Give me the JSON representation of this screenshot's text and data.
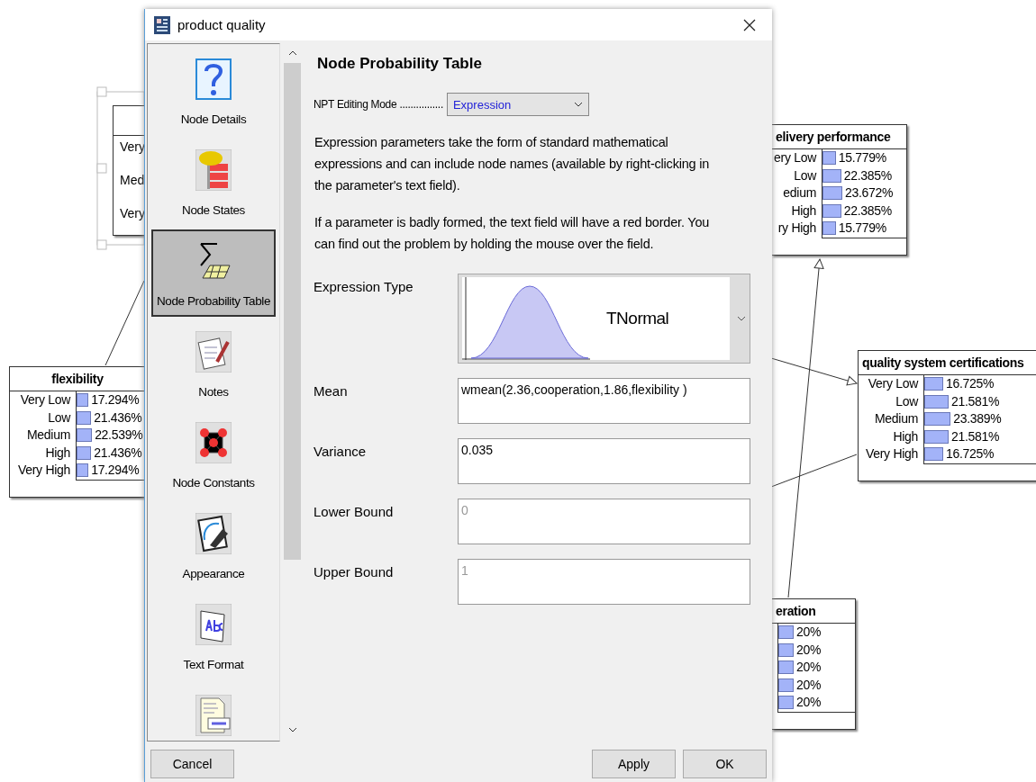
{
  "canvas": {
    "partial_node": {
      "rows": [
        {
          "label": "Very"
        },
        {
          "label": "Med"
        },
        {
          "label": "Very"
        }
      ]
    },
    "nodes": [
      {
        "title": "flexibility",
        "states": [
          {
            "label": "Very Low",
            "value": "17.294%",
            "level": 0.17294
          },
          {
            "label": "Low",
            "value": "21.436%",
            "level": 0.21436
          },
          {
            "label": "Medium",
            "value": "22.539%",
            "level": 0.22539
          },
          {
            "label": "High",
            "value": "21.436%",
            "level": 0.21436
          },
          {
            "label": "Very High",
            "value": "17.294%",
            "level": 0.17294
          }
        ]
      },
      {
        "title": "elivery performance",
        "states": [
          {
            "label": "ery Low",
            "value": "15.779%",
            "level": 0.15779
          },
          {
            "label": "Low",
            "value": "22.385%",
            "level": 0.22385
          },
          {
            "label": "edium",
            "value": "23.672%",
            "level": 0.23672
          },
          {
            "label": "High",
            "value": "22.385%",
            "level": 0.22385
          },
          {
            "label": "ry High",
            "value": "15.779%",
            "level": 0.15779
          }
        ]
      },
      {
        "title": "quality system certifications",
        "states": [
          {
            "label": "Very Low",
            "value": "16.725%",
            "level": 0.16725
          },
          {
            "label": "Low",
            "value": "21.581%",
            "level": 0.21581
          },
          {
            "label": "Medium",
            "value": "23.389%",
            "level": 0.23389
          },
          {
            "label": "High",
            "value": "21.581%",
            "level": 0.21581
          },
          {
            "label": "Very High",
            "value": "16.725%",
            "level": 0.16725
          }
        ]
      },
      {
        "title": "eration",
        "states": [
          {
            "value": "20%",
            "level": 0.2
          },
          {
            "value": "20%",
            "level": 0.2
          },
          {
            "value": "20%",
            "level": 0.2
          },
          {
            "value": "20%",
            "level": 0.2
          },
          {
            "value": "20%",
            "level": 0.2
          }
        ]
      }
    ]
  },
  "window": {
    "title": "product quality"
  },
  "sidebar": {
    "items": [
      {
        "label": "Node Details",
        "selected": false
      },
      {
        "label": "Node States",
        "selected": false
      },
      {
        "label": "Node Probability Table",
        "selected": true
      },
      {
        "label": "Notes",
        "selected": false
      },
      {
        "label": "Node Constants",
        "selected": false
      },
      {
        "label": "Appearance",
        "selected": false
      },
      {
        "label": "Text Format",
        "selected": false
      },
      {
        "selected": false
      }
    ]
  },
  "panel": {
    "heading": "Node Probability Table",
    "mode": {
      "label": "NPT Editing Mode ................",
      "value": "Expression"
    },
    "paragraphs": [
      "Expression parameters take the form of standard mathematical expressions and can include node names (available by right-clicking in the parameter's text field).",
      "If a parameter is badly formed, the text field will have a red border. You can find out the problem by holding the mouse over the field."
    ],
    "expression_type": {
      "label": "Expression Type",
      "value": "TNormal"
    },
    "fields": [
      {
        "label": "Mean",
        "value": "wmean(2.36,cooperation,1.86,flexibility )",
        "disabled": false
      },
      {
        "label": "Variance",
        "value": "0.035",
        "disabled": false
      },
      {
        "label": "Lower Bound",
        "value": "0",
        "disabled": true
      },
      {
        "label": "Upper Bound",
        "value": "1",
        "disabled": true
      }
    ]
  },
  "buttons": {
    "left": [
      "Cancel"
    ],
    "right": [
      "Apply",
      "OK"
    ]
  }
}
